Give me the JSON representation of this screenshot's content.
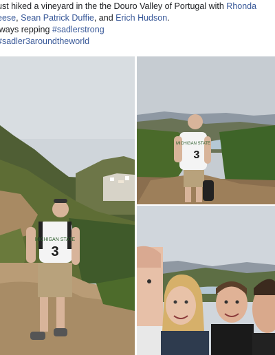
{
  "post": {
    "line1_text": "ust hiked a vineyard in the the Douro  Valley of Portugal with ",
    "line1_mention": "Rhonda",
    "line2_mention1": "eese",
    "line2_sep1": ", ",
    "line2_mention2": "Sean Patrick Duffie",
    "line2_sep2": ", and ",
    "line2_mention3": "Erich Hudson",
    "line2_end": ".",
    "line3_text": "lways repping ",
    "hashtag1": "#sadlerstrong",
    "hashtag2": "#sadler3aroundtheworld"
  },
  "photos": {
    "main_shirt_text": "MICHIGAN STATE",
    "main_shirt_number": "3",
    "top_right_shirt_text": "MICHIGAN STATE",
    "top_right_shirt_number": "3"
  },
  "colors": {
    "link": "#385898",
    "text": "#1c1e21",
    "sky": "#c9d1d8",
    "hill": "#5d6b3c",
    "path": "#b79b75"
  }
}
